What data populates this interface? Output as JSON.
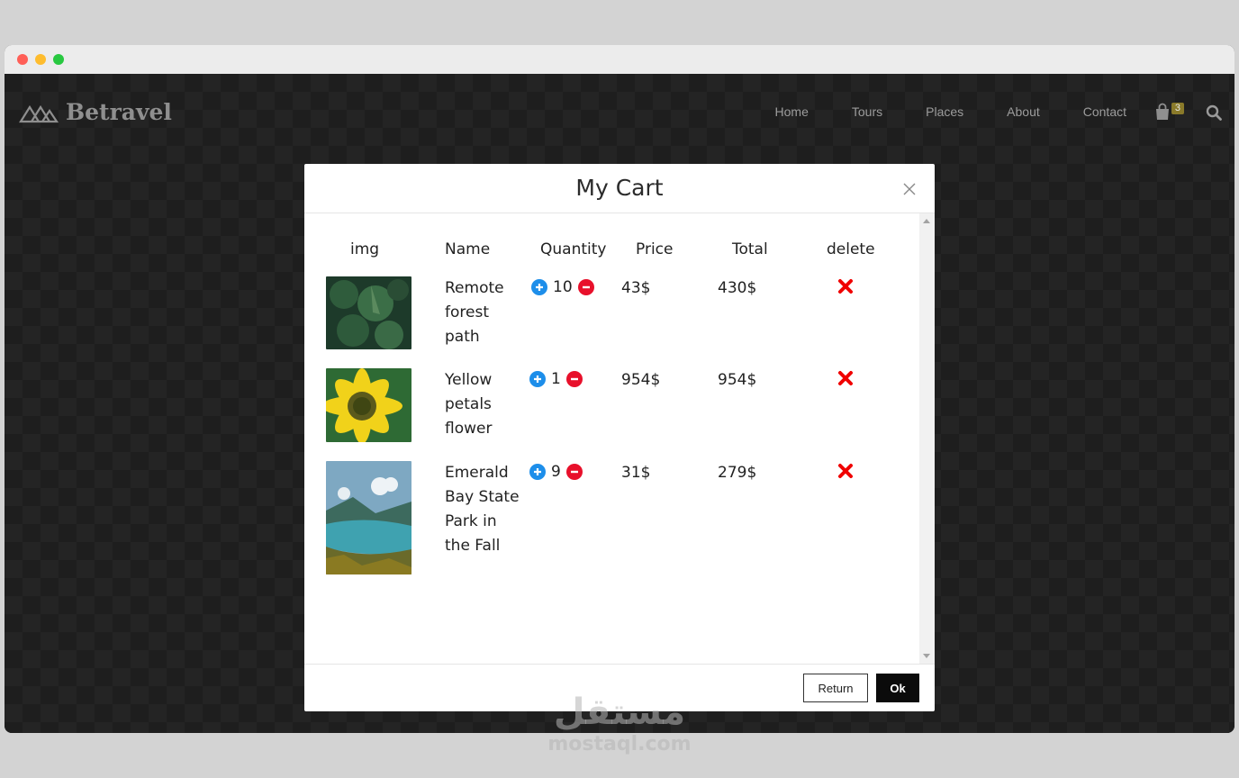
{
  "navbar": {
    "brand": "Betravel",
    "links": [
      "Home",
      "Tours",
      "Places",
      "About",
      "Contact"
    ],
    "cart_count": "3"
  },
  "modal": {
    "title": "My Cart",
    "columns": [
      "img",
      "Name",
      "Quantity",
      "Price",
      "Total",
      "delete"
    ],
    "items": [
      {
        "name": "Remote forest path",
        "quantity": "10",
        "price": "43$",
        "total": "430$"
      },
      {
        "name": "Yellow petals flower",
        "quantity": "1",
        "price": "954$",
        "total": "954$"
      },
      {
        "name": "Emerald Bay State Park in the Fall",
        "quantity": "9",
        "price": "31$",
        "total": "279$"
      }
    ],
    "return_label": "Return",
    "ok_label": "Ok"
  },
  "watermark": {
    "arabic": "مستقل",
    "latin": "mostaql.com"
  },
  "colors": {
    "plus": "#1d8eea",
    "minus": "#e8102b",
    "delete": "#f00000",
    "ok_bg": "#0b0b0b"
  }
}
